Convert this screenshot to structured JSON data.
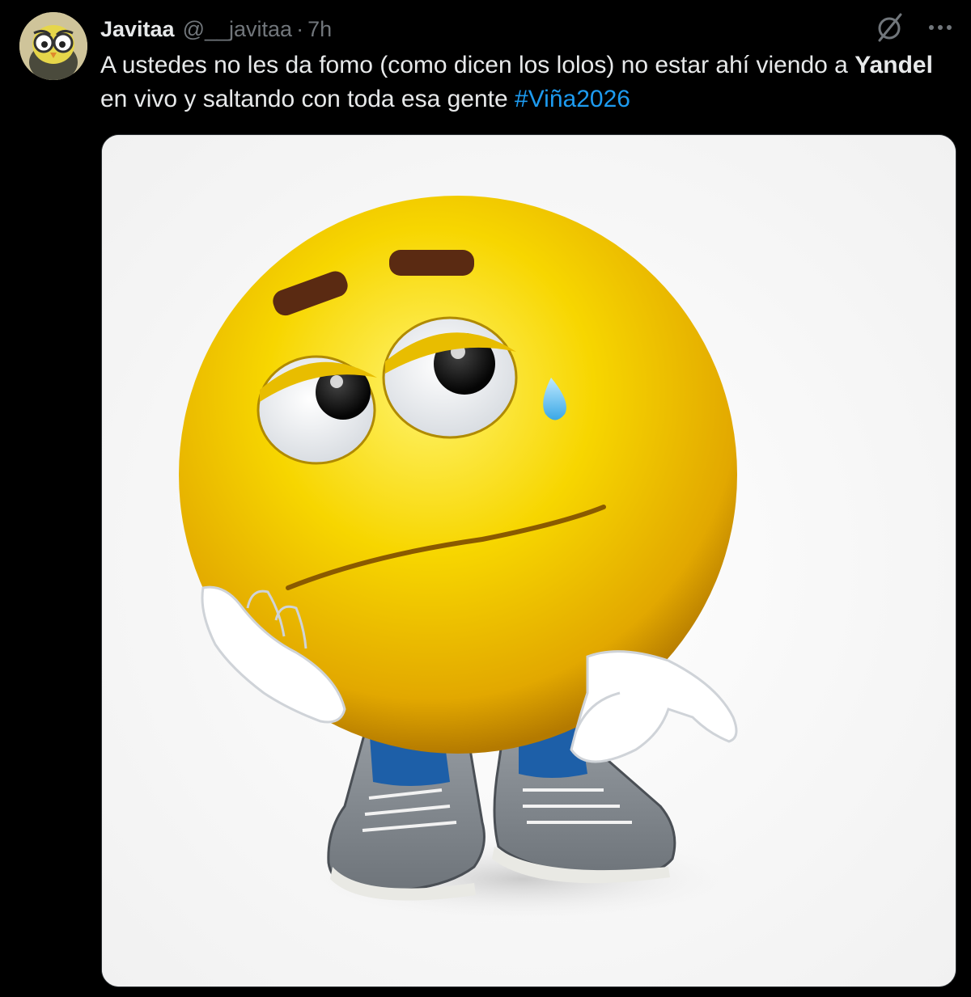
{
  "tweet": {
    "author": {
      "display_name": "Javitaa",
      "handle": "@__javitaa",
      "separator": "·",
      "time": "7h",
      "avatar_icon": "owl-avatar-icon"
    },
    "text": {
      "part1": "A ustedes no les da fomo (como dicen los lolos) no estar ahí viendo a ",
      "bold": "Yandel",
      "part2": " en vivo y saltando con toda esa gente ",
      "hashtag": "#Viña2026"
    },
    "icons": {
      "grok": "grok-icon",
      "more": "more-icon"
    },
    "media": {
      "icon": "sad-crying-emoji-image"
    },
    "colors": {
      "background": "#000000",
      "text": "#e7e9ea",
      "muted": "#71767b",
      "link": "#1d9bf0"
    }
  }
}
